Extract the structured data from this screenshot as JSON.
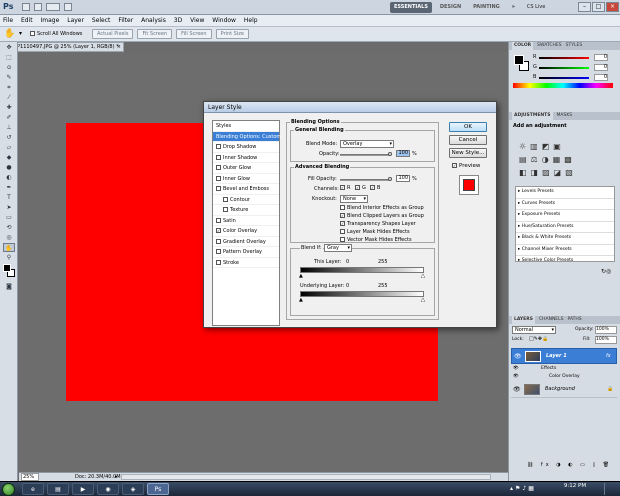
{
  "app": {
    "logo": "Ps"
  },
  "workspaces": [
    "ESSENTIALS",
    "DESIGN",
    "PAINTING"
  ],
  "workspace_extra": "CS Live",
  "menu": [
    "File",
    "Edit",
    "Image",
    "Layer",
    "Select",
    "Filter",
    "Analysis",
    "3D",
    "View",
    "Window",
    "Help"
  ],
  "options": {
    "scroll_all": "Scroll All Windows",
    "buttons": [
      "Actual Pixels",
      "Fit Screen",
      "Fill Screen",
      "Print Size"
    ]
  },
  "document": {
    "tab": "P1110497.JPG @ 25% (Layer 1, RGB/8) *"
  },
  "status": {
    "zoom": "25%",
    "doc": "Doc: 20.3M/40.0M"
  },
  "dialog": {
    "title": "Layer Style",
    "styles": [
      {
        "label": "Styles",
        "check": false,
        "selected": false
      },
      {
        "label": "Blending Options: Custom",
        "check": false,
        "selected": true
      },
      {
        "label": "Drop Shadow",
        "check": true,
        "checked": false
      },
      {
        "label": "Inner Shadow",
        "check": true,
        "checked": false
      },
      {
        "label": "Outer Glow",
        "check": true,
        "checked": false
      },
      {
        "label": "Inner Glow",
        "check": true,
        "checked": false
      },
      {
        "label": "Bevel and Emboss",
        "check": true,
        "checked": false
      },
      {
        "label": "Contour",
        "check": true,
        "checked": false,
        "indent": true
      },
      {
        "label": "Texture",
        "check": true,
        "checked": false,
        "indent": true
      },
      {
        "label": "Satin",
        "check": true,
        "checked": false
      },
      {
        "label": "Color Overlay",
        "check": true,
        "checked": true
      },
      {
        "label": "Gradient Overlay",
        "check": true,
        "checked": false
      },
      {
        "label": "Pattern Overlay",
        "check": true,
        "checked": false
      },
      {
        "label": "Stroke",
        "check": true,
        "checked": false
      }
    ],
    "blending_options": "Blending Options",
    "general_blending": "General Blending",
    "blend_mode_label": "Blend Mode:",
    "blend_mode": "Overlay",
    "opacity_label": "Opacity:",
    "opacity": "100",
    "pct": "%",
    "advanced_blending": "Advanced Blending",
    "fill_opacity_label": "Fill Opacity:",
    "fill_opacity": "100",
    "channels_label": "Channels:",
    "channels": [
      "R",
      "G",
      "B"
    ],
    "knockout_label": "Knockout:",
    "knockout": "None",
    "advanced_checks": [
      {
        "label": "Blend Interior Effects as Group",
        "checked": false
      },
      {
        "label": "Blend Clipped Layers as Group",
        "checked": true
      },
      {
        "label": "Transparency Shapes Layer",
        "checked": true
      },
      {
        "label": "Layer Mask Hides Effects",
        "checked": false
      },
      {
        "label": "Vector Mask Hides Effects",
        "checked": false
      }
    ],
    "blend_if_label": "Blend If:",
    "blend_if": "Gray",
    "this_layer_label": "This Layer:",
    "underlying_label": "Underlying Layer:",
    "range_min": "0",
    "range_max": "255",
    "ok": "OK",
    "cancel": "Cancel",
    "new_style": "New Style...",
    "preview": "Preview",
    "preview_color": "#ff0000"
  },
  "panels": {
    "color_tabs": [
      "COLOR",
      "SWATCHES",
      "STYLES"
    ],
    "color_values": {
      "r": "0",
      "g": "0",
      "b": "0"
    },
    "channel_letters": [
      "R",
      "G",
      "B"
    ],
    "adj_tabs": [
      "ADJUSTMENTS",
      "MASKS"
    ],
    "add_adjustment": "Add an adjustment",
    "presets": [
      "Levels Presets",
      "Curves Presets",
      "Exposure Presets",
      "Hue/Saturation Presets",
      "Black & White Presets",
      "Channel Mixer Presets",
      "Selective Color Presets"
    ],
    "layer_tabs": [
      "LAYERS",
      "CHANNELS",
      "PATHS"
    ],
    "layer_mode": "Normal",
    "opacity_label": "Opacity:",
    "opacity_value": "100%",
    "fill_label": "Fill:",
    "fill_value": "100%",
    "lock_label": "Lock:",
    "fx": "fx",
    "layers": [
      {
        "name": "Layer 1",
        "selected": true
      },
      {
        "name": "Effects",
        "sub": true
      },
      {
        "name": "Color Overlay",
        "sub": true,
        "deep": true
      },
      {
        "name": "Background",
        "selected": false
      }
    ]
  },
  "taskbar": {
    "time": "9:12 PM",
    "date": "7/6/2010"
  }
}
